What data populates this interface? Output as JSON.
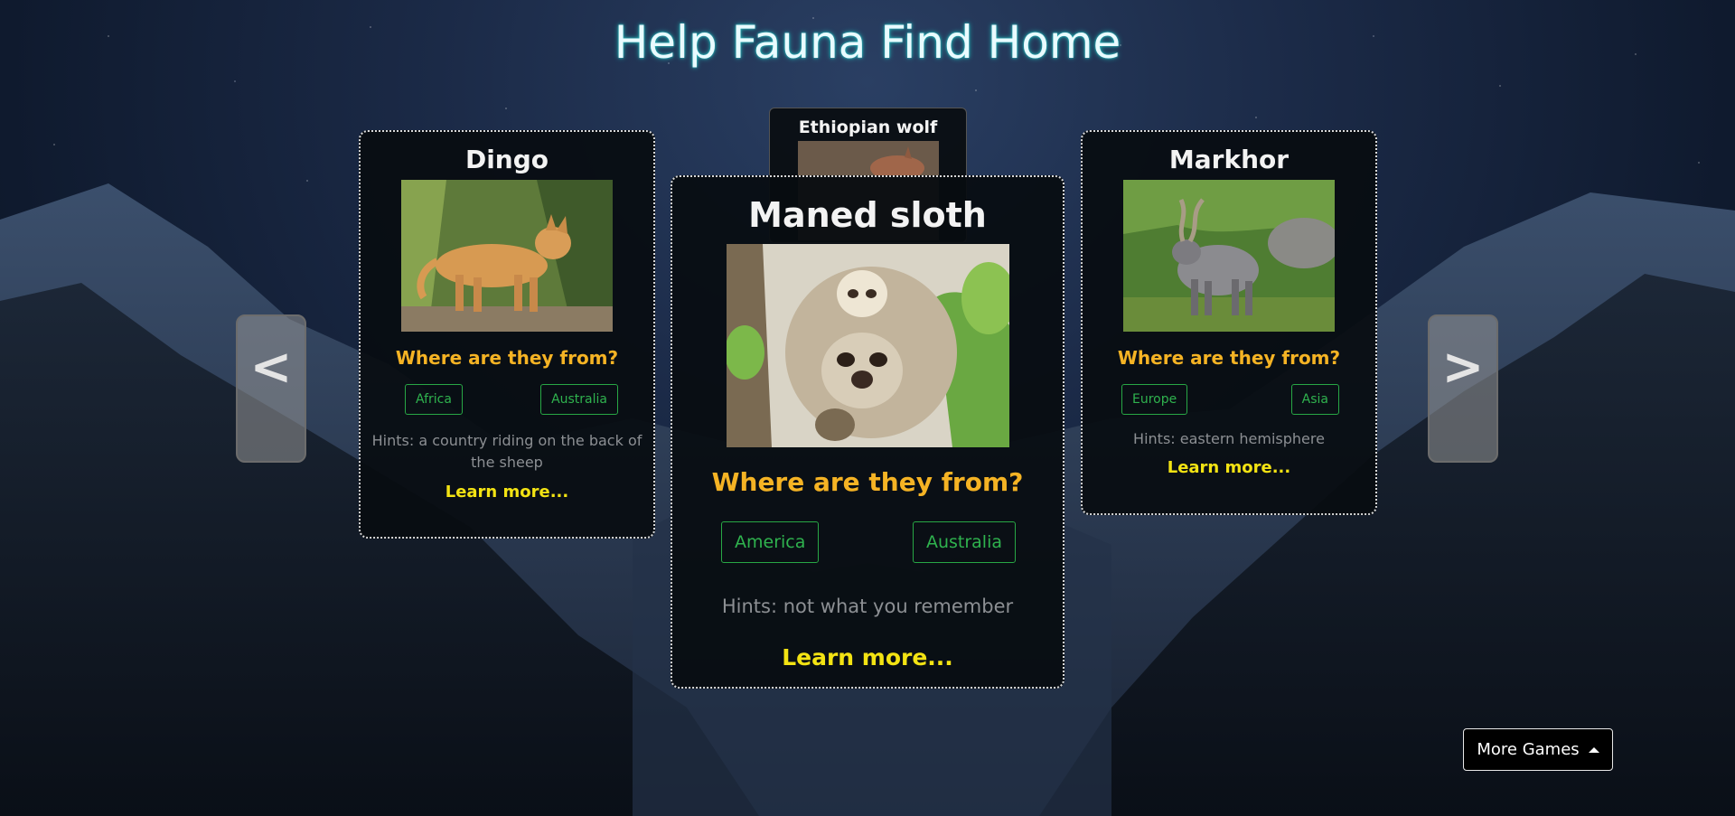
{
  "title": "Help Fauna Find Home",
  "cards": {
    "left": {
      "name": "Dingo",
      "question": "Where are they from?",
      "options": [
        "Africa",
        "Australia"
      ],
      "hint": "Hints: a country riding on the back of the sheep",
      "learn_more": "Learn more..."
    },
    "back": {
      "name": "Ethiopian wolf"
    },
    "front": {
      "name": "Maned sloth",
      "question": "Where are they from?",
      "options": [
        "America",
        "Australia"
      ],
      "hint": "Hints: not what you remember",
      "learn_more": "Learn more..."
    },
    "right": {
      "name": "Markhor",
      "question": "Where are they from?",
      "options": [
        "Europe",
        "Asia"
      ],
      "hint": "Hints: eastern hemisphere",
      "learn_more": "Learn more..."
    }
  },
  "nav": {
    "prev_label": "<",
    "next_label": ">"
  },
  "more_games": {
    "label": "More Games",
    "icon": "caret-up-icon"
  },
  "colors": {
    "question": "#f5b324",
    "answer_button": "#28a745",
    "learn_more": "#f3e313",
    "hint": "#8c8f93",
    "title_glow": "#1fb3b3"
  }
}
